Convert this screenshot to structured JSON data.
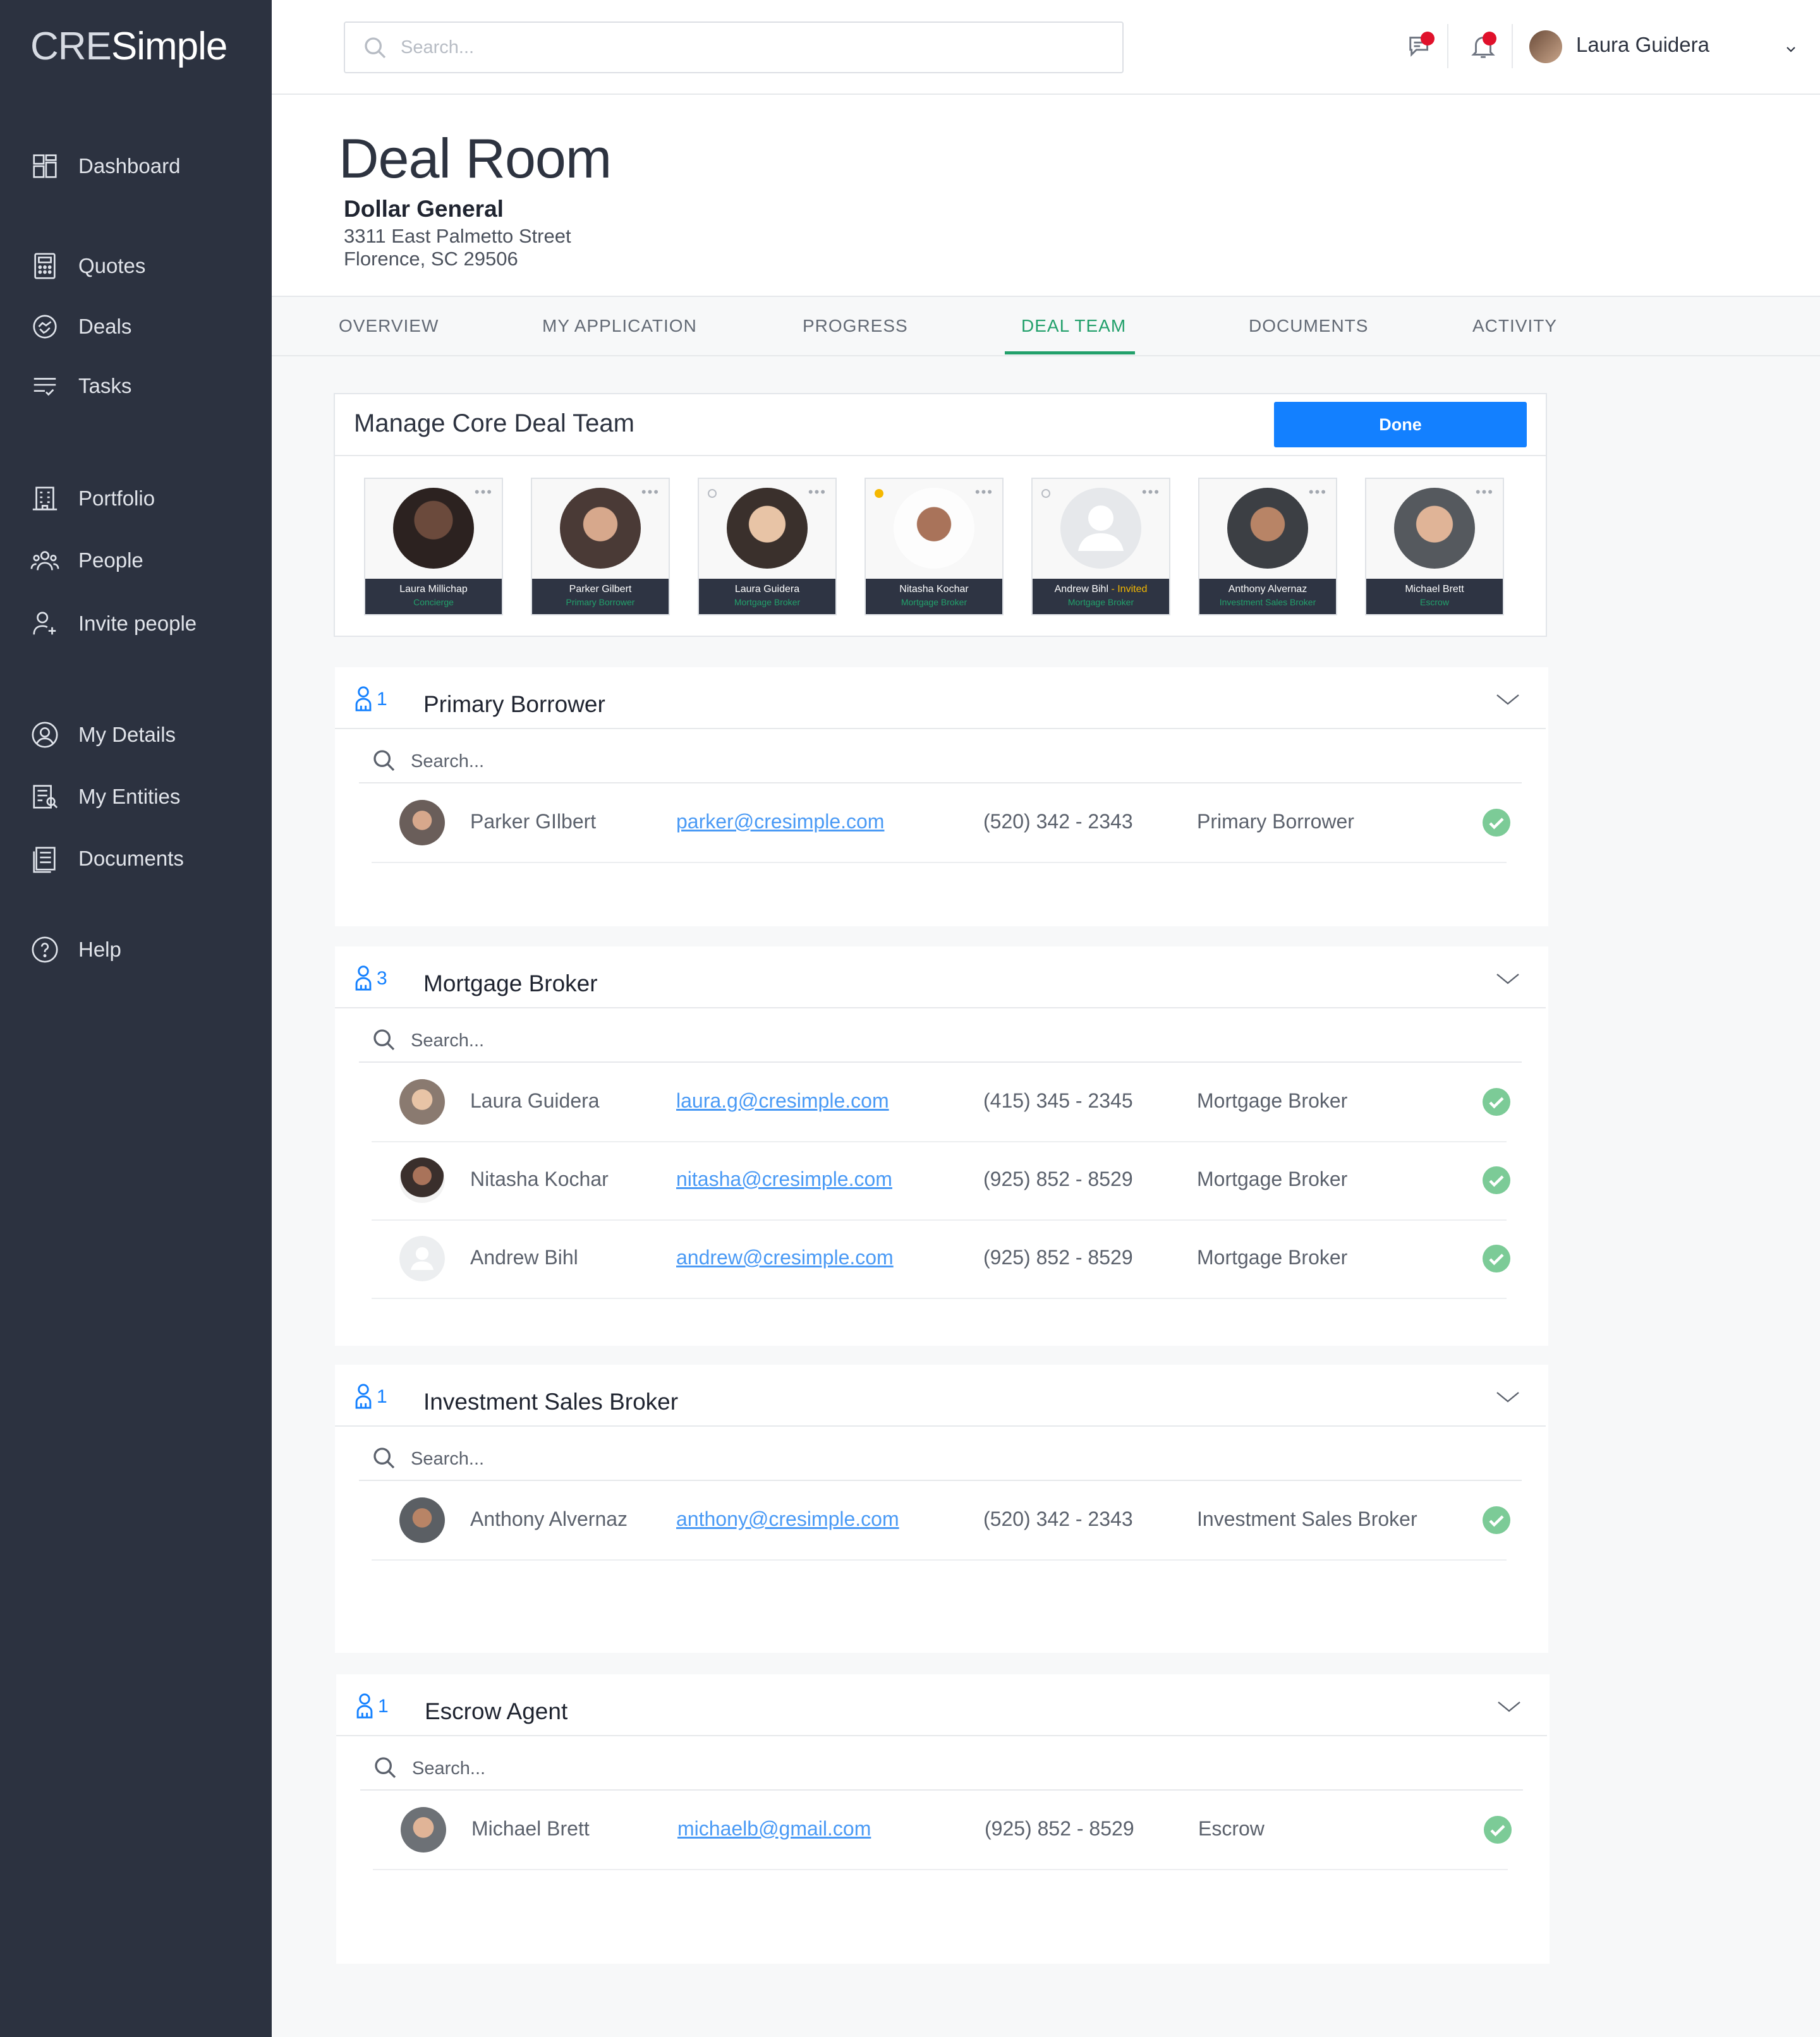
{
  "app": {
    "logo_part1": "CRE",
    "logo_part2": "Simple"
  },
  "sidebar": {
    "items": [
      {
        "label": "Dashboard",
        "icon": "dashboard-icon"
      },
      {
        "label": "Quotes",
        "icon": "calculator-icon"
      },
      {
        "label": "Deals",
        "icon": "handshake-icon"
      },
      {
        "label": "Tasks",
        "icon": "tasks-icon"
      },
      {
        "label": "Portfolio",
        "icon": "building-icon"
      },
      {
        "label": "People",
        "icon": "people-icon"
      },
      {
        "label": "Invite people",
        "icon": "add-user-icon"
      },
      {
        "label": "My Details",
        "icon": "user-circle-icon"
      },
      {
        "label": "My Entities",
        "icon": "entities-icon"
      },
      {
        "label": "Documents",
        "icon": "document-icon"
      },
      {
        "label": "Help",
        "icon": "help-icon"
      }
    ]
  },
  "topbar": {
    "search_placeholder": "Search...",
    "user_name": "Laura Guidera"
  },
  "page": {
    "title": "Deal Room",
    "property_name": "Dollar General",
    "address_line1": "3311 East Palmetto Street",
    "address_line2": "Florence, SC 29506"
  },
  "tabs": [
    {
      "label": "OVERVIEW",
      "active": false
    },
    {
      "label": "MY APPLICATION",
      "active": false
    },
    {
      "label": "PROGRESS",
      "active": false
    },
    {
      "label": "DEAL TEAM",
      "active": true
    },
    {
      "label": "DOCUMENTS",
      "active": false
    },
    {
      "label": "ACTIVITY",
      "active": false
    }
  ],
  "manage": {
    "title": "Manage Core Deal Team",
    "done_label": "Done",
    "members": [
      {
        "name": "Laura Millichap",
        "invited": "",
        "role": "Concierge"
      },
      {
        "name": "Parker Gilbert",
        "invited": "",
        "role": "Primary Borrower"
      },
      {
        "name": "Laura Guidera",
        "invited": "",
        "role": "Mortgage Broker"
      },
      {
        "name": "Nitasha Kochar",
        "invited": "",
        "role": "Mortgage Broker"
      },
      {
        "name": "Andrew Bihl",
        "invited": " - Invited",
        "role": "Mortgage Broker"
      },
      {
        "name": "Anthony Alvernaz",
        "invited": "",
        "role": "Investment Sales Broker"
      },
      {
        "name": "Michael Brett",
        "invited": "",
        "role": "Escrow"
      }
    ]
  },
  "sections": [
    {
      "count": "1",
      "title": "Primary Borrower",
      "search_placeholder": "Search...",
      "rows": [
        {
          "name": "Parker GIlbert",
          "email": "parker@cresimple.com",
          "phone": "(520) 342 - 2343",
          "role": "Primary Borrower"
        }
      ]
    },
    {
      "count": "3",
      "title": "Mortgage Broker",
      "search_placeholder": "Search...",
      "rows": [
        {
          "name": "Laura Guidera",
          "email": "laura.g@cresimple.com",
          "phone": "(415) 345 - 2345",
          "role": "Mortgage Broker"
        },
        {
          "name": "Nitasha Kochar",
          "email": "nitasha@cresimple.com",
          "phone": "(925) 852 - 8529",
          "role": "Mortgage Broker"
        },
        {
          "name": "Andrew Bihl",
          "email": "andrew@cresimple.com",
          "phone": "(925) 852 - 8529",
          "role": "Mortgage Broker"
        }
      ]
    },
    {
      "count": "1",
      "title": "Investment Sales Broker",
      "search_placeholder": "Search...",
      "rows": [
        {
          "name": "Anthony Alvernaz",
          "email": "anthony@cresimple.com",
          "phone": "(520) 342 - 2343",
          "role": "Investment Sales Broker"
        }
      ]
    },
    {
      "count": "1",
      "title": "Escrow Agent",
      "search_placeholder": "Search...",
      "rows": [
        {
          "name": "Michael Brett",
          "email": "michaelb@gmail.com",
          "phone": "(925) 852 - 8529",
          "role": "Escrow"
        }
      ]
    }
  ],
  "colors": {
    "sidebar_bg": "#2c3240",
    "accent_green": "#22a06b",
    "primary_blue": "#1380ff",
    "link_blue": "#4a9af5",
    "notification_red": "#e0112b",
    "check_green": "#7ccb97"
  }
}
